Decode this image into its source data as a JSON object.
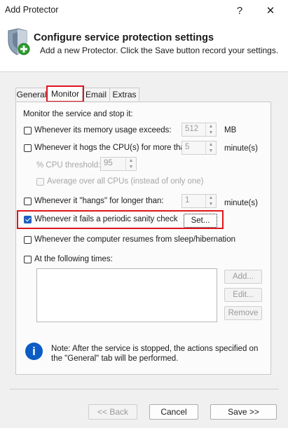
{
  "window": {
    "title": "Add Protector",
    "help": "?",
    "close": "✕"
  },
  "header": {
    "title": "Configure service protection settings",
    "subtitle": "Add a new Protector. Click the Save button record your settings."
  },
  "tabs": [
    {
      "label": "General",
      "active": false
    },
    {
      "label": "Monitor",
      "active": true
    },
    {
      "label": "Email",
      "active": false
    },
    {
      "label": "Extras",
      "active": false
    }
  ],
  "monitor": {
    "section_label": "Monitor the service and stop it:",
    "memory": {
      "label": "Whenever its memory usage exceeds:",
      "value": "512",
      "unit": "MB",
      "checked": false
    },
    "cpu": {
      "label": "Whenever it hogs the CPU(s) for more than:",
      "value": "5",
      "unit": "minute(s)",
      "checked": false
    },
    "cpu_threshold": {
      "label": "% CPU threshold:",
      "value": "95"
    },
    "average_cpus": {
      "label": "Average over all CPUs (instead of only one)",
      "checked": false
    },
    "hangs": {
      "label": "Whenever it \"hangs\" for longer than:",
      "value": "1",
      "unit": "minute(s)",
      "checked": false
    },
    "sanity": {
      "label": "Whenever it fails a periodic sanity check",
      "button": "Set...",
      "checked": true
    },
    "resume": {
      "label": "Whenever the computer resumes from sleep/hibernation",
      "checked": false
    },
    "times": {
      "label": "At the following times:",
      "checked": false
    },
    "times_buttons": {
      "add": "Add...",
      "edit": "Edit...",
      "remove": "Remove"
    },
    "note": "Note: After the service is stopped, the actions specified on the \"General\" tab will be performed."
  },
  "footer": {
    "back": "<< Back",
    "cancel": "Cancel",
    "save": "Save >>"
  },
  "colors": {
    "accent": "#1f5fbf",
    "highlight": "#e0141e",
    "info": "#0b5cc4"
  }
}
